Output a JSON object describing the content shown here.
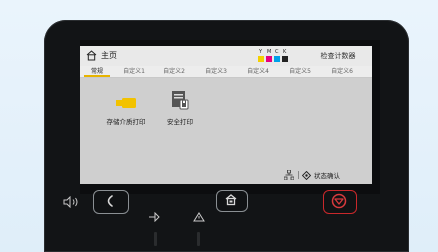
{
  "topbar": {
    "title": "主页",
    "counter_label": "检查计数器"
  },
  "ink": {
    "labels": [
      "Y",
      "M",
      "C",
      "K"
    ],
    "colors": [
      "#f4d000",
      "#e6007e",
      "#00a0e9",
      "#222222"
    ]
  },
  "tabs": [
    {
      "label": "常规",
      "active": true
    },
    {
      "label": "自定义1",
      "active": false
    },
    {
      "label": "自定义2",
      "active": false
    },
    {
      "label": "自定义3",
      "active": false
    },
    {
      "label": "自定义4",
      "active": false
    },
    {
      "label": "自定义5",
      "active": false
    },
    {
      "label": "自定义6",
      "active": false
    }
  ],
  "tiles": [
    {
      "label": "存储介质打印",
      "icon": "usb-drive-icon"
    },
    {
      "label": "安全打印",
      "icon": "secure-print-icon"
    }
  ],
  "status": {
    "label": "状态确认"
  },
  "colors": {
    "accent": "#e7b400",
    "stop": "#c9282b"
  }
}
